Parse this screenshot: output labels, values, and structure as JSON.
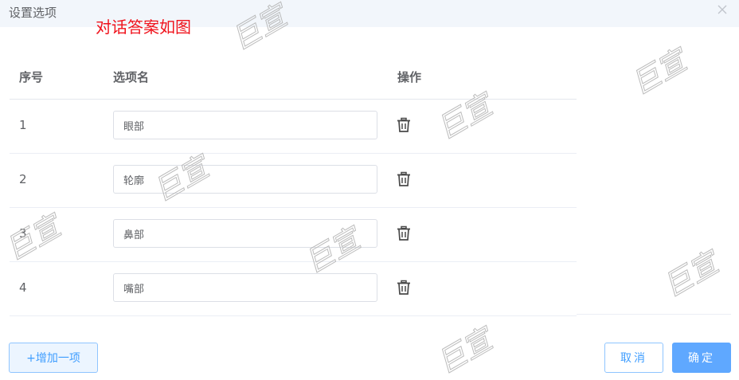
{
  "dialog": {
    "title": "设置选项",
    "annotation": "对话答案如图"
  },
  "table": {
    "headers": {
      "index": "序号",
      "name": "选项名",
      "action": "操作"
    },
    "rows": [
      {
        "index": "1",
        "value": "眼部"
      },
      {
        "index": "2",
        "value": "轮廓"
      },
      {
        "index": "3",
        "value": "鼻部"
      },
      {
        "index": "4",
        "value": "嘴部"
      }
    ]
  },
  "footer": {
    "add_label": "+增加一项",
    "cancel_label": "取消",
    "confirm_label": "确定"
  },
  "icons": {
    "close": "close-icon",
    "delete": "trash-icon"
  },
  "watermark": {
    "text": "巨宣"
  },
  "colors": {
    "accent": "#409eff",
    "annotation": "#f0131c",
    "header_bg": "#f2f6fb"
  }
}
